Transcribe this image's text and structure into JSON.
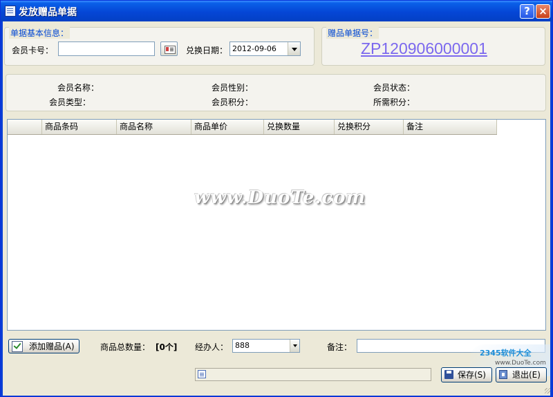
{
  "window": {
    "title": "发放赠品单据"
  },
  "titlebar": {
    "help_label": "?",
    "close_label": "×"
  },
  "basic_info": {
    "group_title": "单据基本信息：",
    "member_card_label": "会员卡号：",
    "member_card_value": "",
    "exchange_date_label": "兑换日期：",
    "exchange_date_value": "2012-09-06"
  },
  "doc_number": {
    "group_title": "赠品单据号：",
    "value": "ZP120906000001"
  },
  "member_info": {
    "name_label": "会员名称：",
    "gender_label": "会员性别：",
    "status_label": "会员状态：",
    "type_label": "会员类型：",
    "points_label": "会员积分：",
    "required_points_label": "所需积分："
  },
  "table": {
    "columns": [
      "",
      "商品条码",
      "商品名称",
      "商品单价",
      "兑换数量",
      "兑换积分",
      "备注"
    ],
    "rows": []
  },
  "watermark": "www.DuoTe.com",
  "footer": {
    "add_gift_label": "添加赠品(A)",
    "total_qty_label": "商品总数量：",
    "total_qty_value": "[0个]",
    "handler_label": "经办人：",
    "handler_value": "888",
    "remark_label": "备注：",
    "remark_value": ""
  },
  "actions": {
    "save_label": "保存(S)",
    "exit_label": "退出(E)"
  },
  "corner_logo": {
    "brand": "2345软件大全",
    "url": "www.DuoTe.com"
  },
  "colors": {
    "title_blue": "#0546d6",
    "group_title": "#0046d5",
    "doc_number": "#7b68ee",
    "face": "#ece9d8"
  }
}
